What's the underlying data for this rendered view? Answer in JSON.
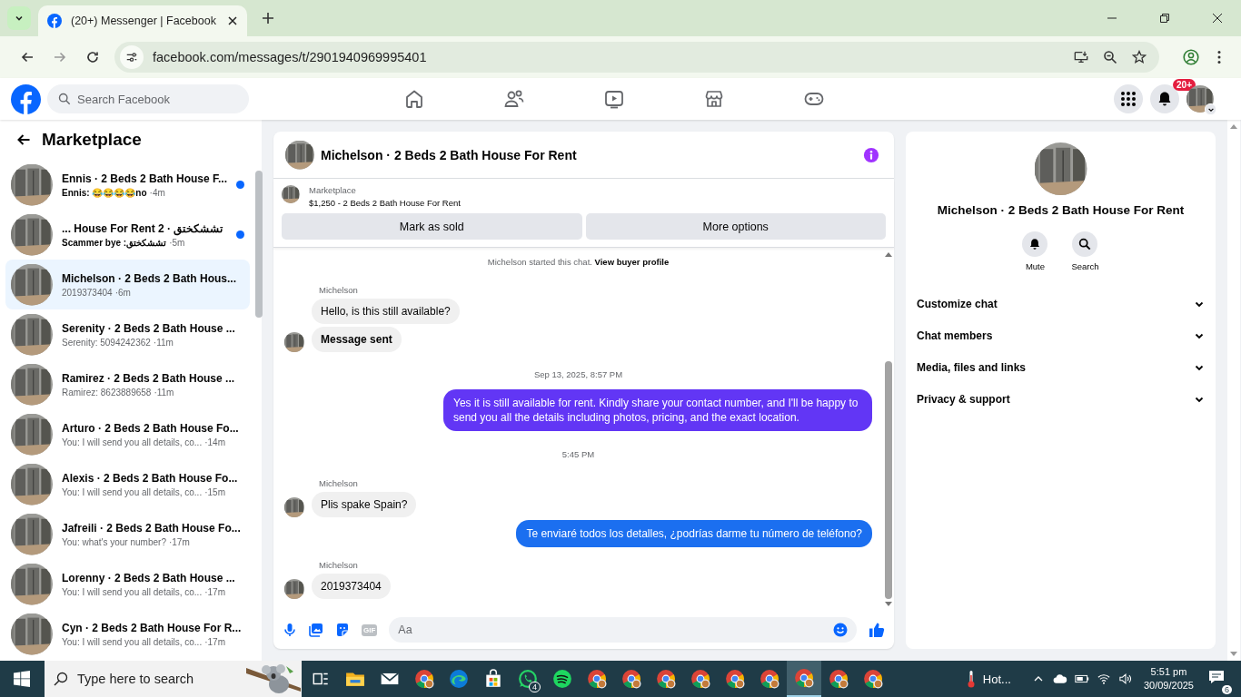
{
  "browser": {
    "tab_title": "(20+) Messenger | Facebook",
    "url": "facebook.com/messages/t/2901940969995401"
  },
  "facebook_bar": {
    "search_placeholder": "Search Facebook",
    "nav": [
      {
        "kind": "home"
      },
      {
        "kind": "friends"
      },
      {
        "kind": "video"
      },
      {
        "kind": "marketplace"
      },
      {
        "kind": "gaming"
      }
    ],
    "notification_badge": "20+"
  },
  "sidebar": {
    "title": "Marketplace",
    "conversations": [
      {
        "name": "Ennis · 2 Beds 2 Bath House F...",
        "preview": "Ennis: 😂😂😂😂no",
        "time": "·4m",
        "unread": true,
        "selected": false
      },
      {
        "name": "... House For Rent 2 · تششكختق",
        "preview": "Scammer bye :تششكختق",
        "time": "·5m",
        "unread": true,
        "selected": false
      },
      {
        "name": "Michelson · 2 Beds 2 Bath Hous...",
        "preview": "2019373404",
        "time": "·6m",
        "unread": false,
        "selected": true
      },
      {
        "name": "Serenity · 2 Beds 2 Bath House ...",
        "preview": "Serenity: 5094242362",
        "time": "·11m",
        "unread": false,
        "selected": false
      },
      {
        "name": "Ramirez · 2 Beds 2 Bath House ...",
        "preview": "Ramirez: 8623889658",
        "time": "·11m",
        "unread": false,
        "selected": false
      },
      {
        "name": "Arturo · 2 Beds 2 Bath House Fo...",
        "preview": "You: I will send you all details, co...",
        "time": "·14m",
        "unread": false,
        "selected": false
      },
      {
        "name": "Alexis · 2 Beds 2 Bath House Fo...",
        "preview": "You: I will send you all details, co...",
        "time": "·15m",
        "unread": false,
        "selected": false
      },
      {
        "name": "Jafreili · 2 Beds 2 Bath House Fo...",
        "preview": "You: what's your number?",
        "time": "·17m",
        "unread": false,
        "selected": false
      },
      {
        "name": "Lorenny · 2 Beds 2 Bath House ...",
        "preview": "You: I will send you all details, co...",
        "time": "·17m",
        "unread": false,
        "selected": false
      },
      {
        "name": "Cyn · 2 Beds 2 Bath House For R...",
        "preview": "You: I will send you all details, co...",
        "time": "·17m",
        "unread": false,
        "selected": false
      }
    ]
  },
  "chat": {
    "title": "Michelson · 2 Beds 2 Bath House For Rent",
    "listing": {
      "source": "Marketplace",
      "item": "$1,250 - 2 Beds 2 Bath House For Rent"
    },
    "actions": [
      "Mark as sold",
      "More options"
    ],
    "started": {
      "text": "Michelson started this chat.",
      "link": "View buyer profile"
    },
    "messages": [
      {
        "kind": "sender",
        "text": "Michelson"
      },
      {
        "kind": "incoming",
        "text": "Hello, is this still available?",
        "avatar": false,
        "emphasis": false
      },
      {
        "kind": "incoming",
        "text": "Message sent",
        "avatar": true,
        "emphasis": true
      },
      {
        "kind": "time",
        "text": "Sep 13, 2025, 8:57 PM"
      },
      {
        "kind": "outgoing",
        "text": "Yes it is still available for rent. Kindly share your contact number, and I'll be happy to send you all the details including photos, pricing, and the exact location.",
        "color": "#6236f5"
      },
      {
        "kind": "time",
        "text": "5:45 PM"
      },
      {
        "kind": "sender",
        "text": "Michelson"
      },
      {
        "kind": "incoming",
        "text": "Plis spake Spain?",
        "avatar": true,
        "emphasis": false
      },
      {
        "kind": "outgoing",
        "text": "Te enviaré todos los detalles, ¿podrías darme tu número de teléfono?",
        "color": "#1b6ff0"
      },
      {
        "kind": "sender",
        "text": "Michelson"
      },
      {
        "kind": "incoming",
        "text": "2019373404",
        "avatar": true,
        "emphasis": false
      }
    ],
    "composer": {
      "gif": "GIF",
      "placeholder": "Aa"
    }
  },
  "info": {
    "title": "Michelson · 2 Beds 2 Bath House For Rent",
    "buttons": [
      {
        "kind": "mute",
        "label": "Mute"
      },
      {
        "kind": "search",
        "label": "Search"
      }
    ],
    "sections": [
      {
        "label": "Customize chat",
        "expanded": false
      },
      {
        "label": "Chat members",
        "expanded": false
      },
      {
        "label": "Media, files and links",
        "expanded": false
      },
      {
        "label": "Privacy & support",
        "expanded": false
      }
    ]
  },
  "taskbar": {
    "search_placeholder": "Type here to search",
    "apps": [
      {
        "kind": "taskview",
        "selected": false
      },
      {
        "kind": "explorer",
        "selected": false
      },
      {
        "kind": "mail",
        "selected": false
      },
      {
        "kind": "chrome",
        "selected": false
      },
      {
        "kind": "edge",
        "selected": false
      },
      {
        "kind": "store",
        "selected": false
      },
      {
        "kind": "whatsapp",
        "selected": false,
        "badge": "4"
      },
      {
        "kind": "spotify",
        "selected": false
      },
      {
        "kind": "chrome",
        "selected": false
      },
      {
        "kind": "chrome",
        "selected": false
      },
      {
        "kind": "chrome",
        "selected": false
      },
      {
        "kind": "chrome",
        "selected": false
      },
      {
        "kind": "chrome",
        "selected": false
      },
      {
        "kind": "chrome",
        "selected": false
      },
      {
        "kind": "chrome",
        "selected": true
      },
      {
        "kind": "chrome",
        "selected": false
      },
      {
        "kind": "chrome",
        "selected": false
      }
    ],
    "weather": "Hot...",
    "time": "5:51 pm",
    "date": "30/09/2025",
    "notifications": "6"
  }
}
